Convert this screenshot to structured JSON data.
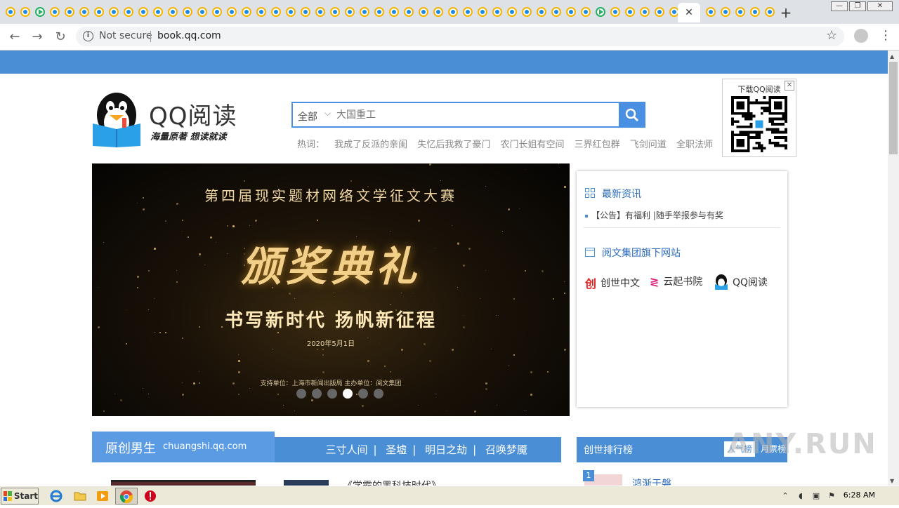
{
  "browser": {
    "new_tab_label": "+",
    "active_tab_close": "✕",
    "window_buttons": [
      "—",
      "❐",
      "✕"
    ],
    "nav": {
      "back": "←",
      "forward": "→",
      "reload": "↻"
    },
    "security_text": "Not secure",
    "url": "book.qq.com",
    "star": "☆",
    "menu": "⋮"
  },
  "site": {
    "logo_title": "QQ阅读",
    "logo_slogan": "海量原著  想读就读",
    "search": {
      "category": "全部",
      "placeholder": "大国重工"
    },
    "hot_label": "热词：",
    "hot_words": [
      "我成了反派的亲闺",
      "失忆后我救了豪门",
      "农门长姐有空间",
      "三界红包群",
      "飞剑问道",
      "全职法师"
    ],
    "qr_label": "下载QQ阅读",
    "qr_close": "✕"
  },
  "banner": {
    "title": "第四届现实题材网络文学征文大赛",
    "main": "颁奖典礼",
    "sub": "书写新时代  扬帆新征程",
    "date": "2020年5月1日",
    "org": "支持单位：上海市新闻出版局     主办单位：阅文集团",
    "slides": 6,
    "active_slide": 4
  },
  "news": {
    "latest_heading": "最新资讯",
    "latest_item": "【公告】有福利 |随手举报参与有奖",
    "group_heading": "阅文集团旗下网站",
    "sites": [
      "创世中文",
      "云起书院",
      "QQ阅读"
    ]
  },
  "section": {
    "tab_cn": "原创男生",
    "tab_en": "chuangshi.qq.com",
    "links": [
      "三寸人间",
      "圣墟",
      "明日之劫",
      "召唤梦魇"
    ],
    "book_title": "《学霸的黑科技时代》"
  },
  "ranking": {
    "title": "创世排行榜",
    "tab_popular": "人气榜",
    "tab_monthly": "月票榜",
    "first_rank": "1",
    "first_name": "鸿渐于磐"
  },
  "watermark": "ANY.RUN",
  "taskbar": {
    "start_label": "Start",
    "clock": "6:28 AM"
  },
  "colors": {
    "accent": "#4a8fd6",
    "tab_bg": "#dee1e6"
  }
}
